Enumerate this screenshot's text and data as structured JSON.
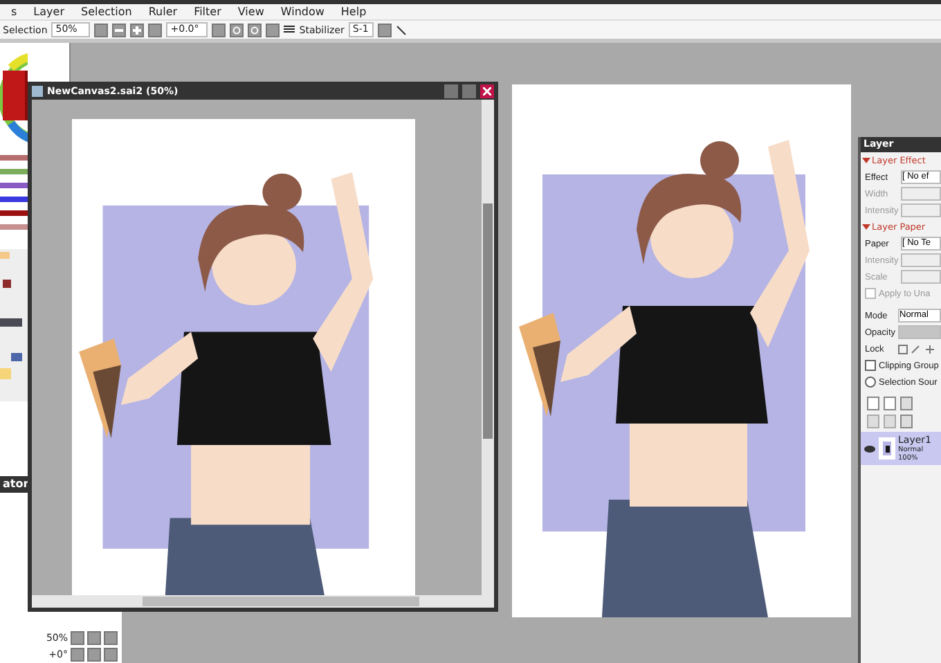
{
  "menu": [
    {
      "label": "s"
    },
    {
      "label": "Layer"
    },
    {
      "label": "Selection"
    },
    {
      "label": "Ruler"
    },
    {
      "label": "Filter"
    },
    {
      "label": "View"
    },
    {
      "label": "Window"
    },
    {
      "label": "Help"
    }
  ],
  "toolbar": {
    "selection_label": "Selection",
    "zoom": "50%",
    "rotation": "+0.0°",
    "stabilizer_label": "Stabilizer",
    "stabilizer": "S-1"
  },
  "navigator": {
    "title": "ator",
    "zoom": "50%",
    "rotation": "+0°"
  },
  "canvas_window": {
    "title": "NewCanvas2.sai2 (50%)"
  },
  "layer_panel": {
    "title": "Layer",
    "sections": [
      {
        "heading": "Layer Effect",
        "expanded": true,
        "rows": [
          {
            "label": "Effect",
            "value": "[ No ef",
            "disabled": false
          },
          {
            "label": "Width",
            "disabled": true
          },
          {
            "label": "Intensity",
            "disabled": true
          }
        ]
      },
      {
        "heading": "Layer Paper",
        "expanded": true,
        "rows": [
          {
            "label": "Paper",
            "value": "[ No Te",
            "disabled": false
          },
          {
            "label": "Intensity",
            "disabled": true
          },
          {
            "label": "Scale",
            "disabled": true
          }
        ],
        "checkbox": {
          "label": "Apply to Una",
          "checked": false,
          "disabled": true
        }
      }
    ],
    "mode_label": "Mode",
    "mode": "Normal",
    "opacity_label": "Opacity",
    "opacity_slider": {
      "level": 1
    },
    "lock_label": "Lock",
    "options": [
      {
        "label": "Clipping Group",
        "kind": "checkbox",
        "checked": false
      },
      {
        "label": "Selection Sour",
        "kind": "radio",
        "checked": false
      }
    ],
    "layers": [
      {
        "name": "Layer1",
        "mode": "Normal",
        "opacity": "100%",
        "selected": true,
        "visible": true
      }
    ]
  }
}
